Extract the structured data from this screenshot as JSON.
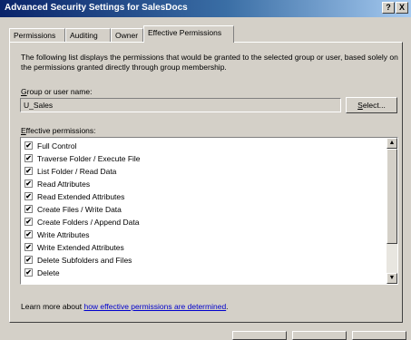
{
  "window": {
    "title": "Advanced Security Settings for SalesDocs",
    "help_label": "?",
    "close_label": "X"
  },
  "tabs": [
    {
      "label": "Permissions"
    },
    {
      "label": "Auditing"
    },
    {
      "label": "Owner"
    },
    {
      "label": "Effective Permissions",
      "active": true
    }
  ],
  "main": {
    "description": "The following list displays the permissions that would be granted to the selected group or user, based solely on the permissions granted directly through group membership.",
    "group_label": "Group or user name:",
    "group_value": "U_Sales",
    "select_button": "Select...",
    "permissions_label": "Effective permissions:",
    "permissions": [
      {
        "label": "Full Control",
        "checked": true
      },
      {
        "label": "Traverse Folder / Execute File",
        "checked": true
      },
      {
        "label": "List Folder / Read Data",
        "checked": true
      },
      {
        "label": "Read Attributes",
        "checked": true
      },
      {
        "label": "Read Extended Attributes",
        "checked": true
      },
      {
        "label": "Create Files / Write Data",
        "checked": true
      },
      {
        "label": "Create Folders / Append Data",
        "checked": true
      },
      {
        "label": "Write Attributes",
        "checked": true
      },
      {
        "label": "Write Extended Attributes",
        "checked": true
      },
      {
        "label": "Delete Subfolders and Files",
        "checked": true
      },
      {
        "label": "Delete",
        "checked": true
      }
    ],
    "learn_more_prefix": "Learn more about ",
    "learn_more_link": "how effective permissions are determined",
    "learn_more_suffix": "."
  },
  "icons": {
    "check": "✔",
    "scroll_up": "▲",
    "scroll_down": "▼"
  }
}
